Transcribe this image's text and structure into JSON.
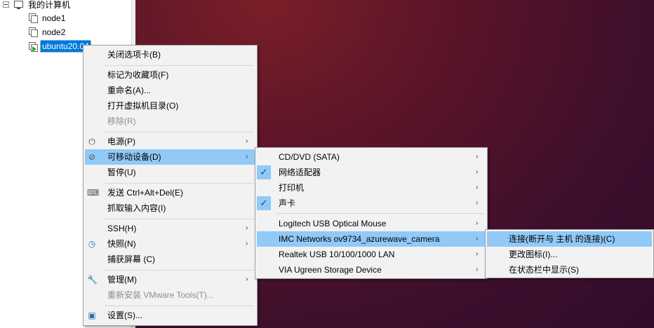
{
  "library": {
    "root_label": "我的计算机",
    "vms": [
      {
        "label": "node1"
      },
      {
        "label": "node2"
      },
      {
        "label": "ubuntu20.04"
      }
    ]
  },
  "context_menu": {
    "items": [
      {
        "label": "关闭选项卡(B)"
      },
      {
        "label": "标记为收藏项(F)"
      },
      {
        "label": "重命名(A)..."
      },
      {
        "label": "打开虚拟机目录(O)"
      },
      {
        "label": "移除(R)"
      },
      {
        "label": "电源(P)"
      },
      {
        "label": "可移动设备(D)"
      },
      {
        "label": "暂停(U)"
      },
      {
        "label": "发送 Ctrl+Alt+Del(E)"
      },
      {
        "label": "抓取输入内容(I)"
      },
      {
        "label": "SSH(H)"
      },
      {
        "label": "快照(N)"
      },
      {
        "label": "捕获屏幕 (C)"
      },
      {
        "label": "管理(M)"
      },
      {
        "label": "重新安装 VMware Tools(T)..."
      },
      {
        "label": "设置(S)..."
      }
    ]
  },
  "removable_menu": {
    "items": [
      {
        "label": "CD/DVD (SATA)"
      },
      {
        "label": "网络适配器"
      },
      {
        "label": "打印机"
      },
      {
        "label": "声卡"
      },
      {
        "label": "Logitech USB Optical Mouse"
      },
      {
        "label": "IMC Networks ov9734_azurewave_camera"
      },
      {
        "label": "Realtek USB 10/100/1000 LAN"
      },
      {
        "label": "VIA Ugreen Storage Device"
      }
    ]
  },
  "device_menu": {
    "items": [
      {
        "label": "连接(断开与 主机 的连接)(C)"
      },
      {
        "label": "更改图标(I)..."
      },
      {
        "label": "在状态栏中显示(S)"
      }
    ]
  },
  "glyphs": {
    "arrow": "›",
    "check": "✓",
    "power": "⏻",
    "removable": "⊘",
    "keyboard": "⌨",
    "snapshot": "◷",
    "wrench": "🔧",
    "settings": "▣"
  }
}
